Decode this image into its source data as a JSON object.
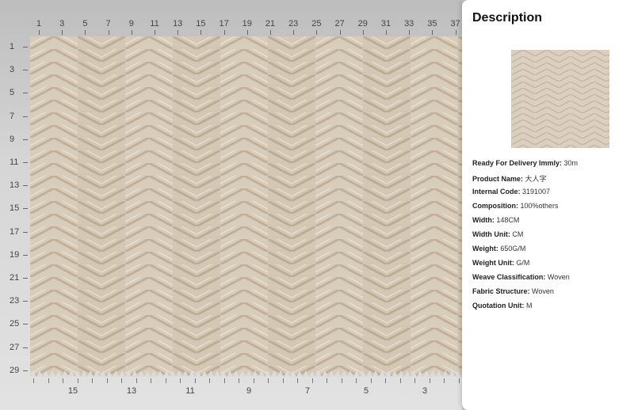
{
  "ruler_top": [
    "1",
    "3",
    "5",
    "7",
    "9",
    "11",
    "13",
    "15",
    "17",
    "19",
    "21",
    "23",
    "25",
    "27",
    "29",
    "31",
    "33",
    "35",
    "37"
  ],
  "ruler_left": [
    "1",
    "3",
    "5",
    "7",
    "9",
    "11",
    "13",
    "15",
    "17",
    "19",
    "21",
    "23",
    "25",
    "27",
    "29"
  ],
  "ruler_bottom": [
    "15",
    "13",
    "11",
    "9",
    "7",
    "5",
    "3"
  ],
  "panel": {
    "title": "Description",
    "specs": [
      {
        "label": "Ready For Delivery Immly:",
        "value": "30m"
      },
      {
        "label": "Product Name:",
        "value": "大人字"
      },
      {
        "label": "Internal Code:",
        "value": "3191007"
      },
      {
        "label": "Composition:",
        "value": "100%others"
      },
      {
        "label": "Width:",
        "value": "148CM"
      },
      {
        "label": "Width Unit:",
        "value": "CM"
      },
      {
        "label": "Weight:",
        "value": "650G/M"
      },
      {
        "label": "Weight Unit:",
        "value": "G/M"
      },
      {
        "label": "Weave Classification:",
        "value": "Woven"
      },
      {
        "label": "Fabric Structure:",
        "value": "Woven"
      },
      {
        "label": "Quotation Unit:",
        "value": "M"
      }
    ]
  },
  "colors": {
    "fabric": "#d6cab8",
    "fabric_dark": "#bfb19c",
    "fabric_light": "#e6dccd"
  }
}
